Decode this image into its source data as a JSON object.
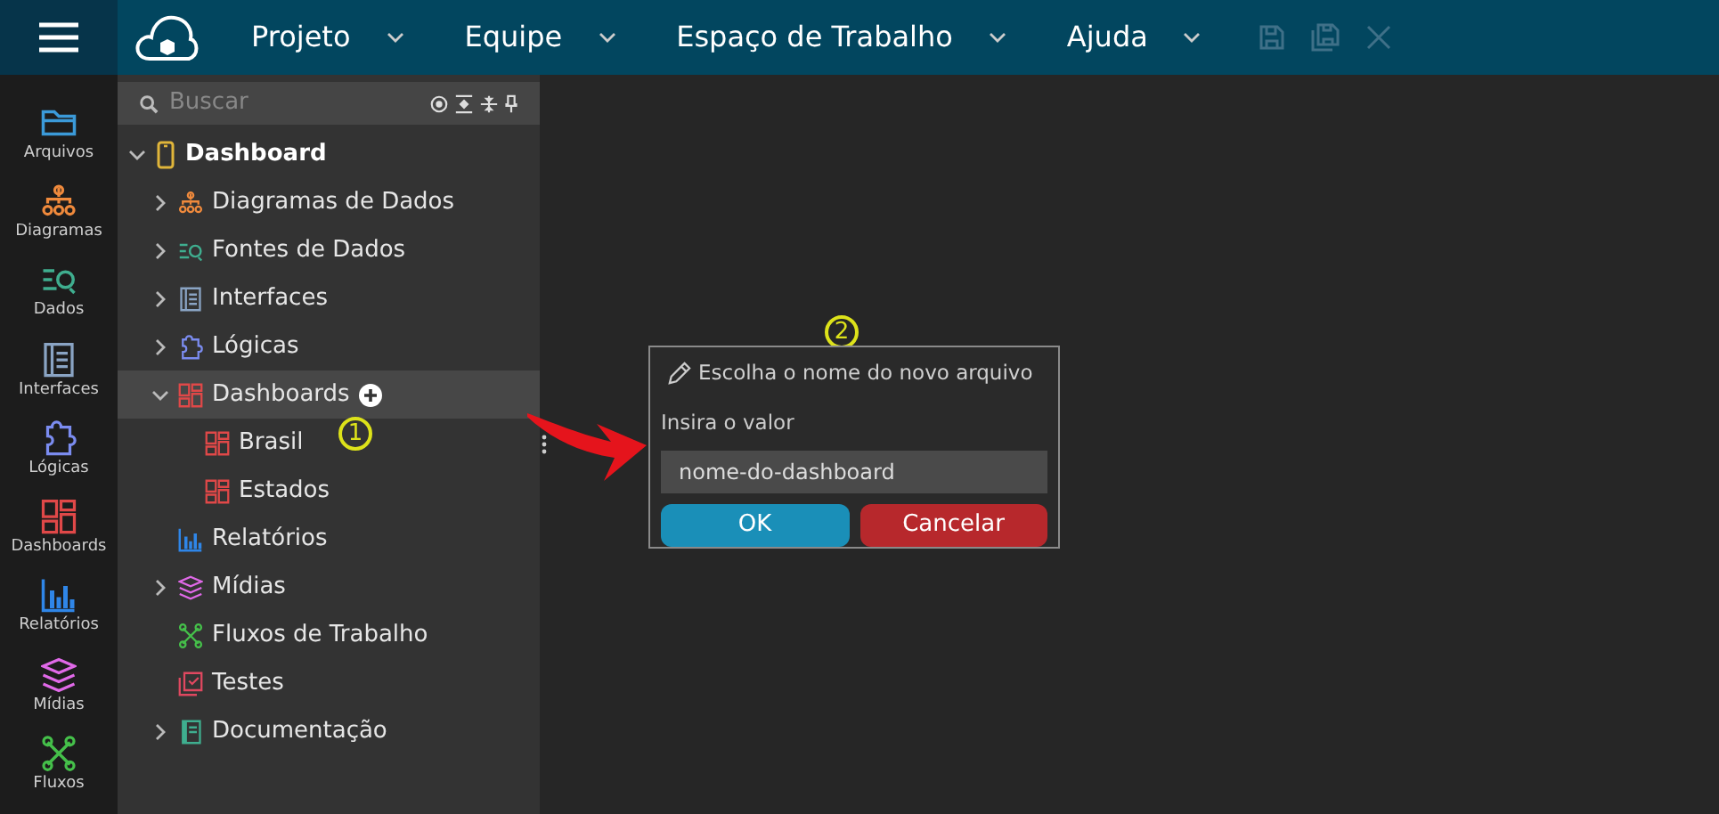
{
  "menu": [
    {
      "label": "Projeto"
    },
    {
      "label": "Equipe"
    },
    {
      "label": "Espaço de Trabalho"
    },
    {
      "label": "Ajuda"
    }
  ],
  "rail": [
    {
      "label": "Arquivos",
      "kind": "folder",
      "color": "#3b9ad9"
    },
    {
      "label": "Diagramas",
      "kind": "diagram",
      "color": "#f08a3c"
    },
    {
      "label": "Dados",
      "kind": "data",
      "color": "#3fae8f"
    },
    {
      "label": "Interfaces",
      "kind": "interface",
      "color": "#8aa4c4"
    },
    {
      "label": "Lógicas",
      "kind": "logic",
      "color": "#7b8cf0"
    },
    {
      "label": "Dashboards",
      "kind": "dashboard",
      "color": "#e04848"
    },
    {
      "label": "Relatórios",
      "kind": "report",
      "color": "#2f86e8"
    },
    {
      "label": "Mídias",
      "kind": "media",
      "color": "#e069e8"
    },
    {
      "label": "Fluxos",
      "kind": "flow",
      "color": "#45c04a"
    }
  ],
  "search": {
    "placeholder": "Buscar"
  },
  "tree": {
    "label": "Dashboard",
    "expanded": true,
    "children": [
      {
        "label": "Diagramas de Dados",
        "kind": "diagram",
        "color": "#f08a3c",
        "expanded": false,
        "selected": false
      },
      {
        "label": "Fontes de Dados",
        "kind": "data",
        "color": "#3fae8f",
        "expanded": false,
        "selected": false
      },
      {
        "label": "Interfaces",
        "kind": "interface",
        "color": "#8aa4c4",
        "expanded": false,
        "selected": false
      },
      {
        "label": "Lógicas",
        "kind": "logic",
        "color": "#7b8cf0",
        "expanded": false,
        "selected": false
      },
      {
        "label": "Dashboards",
        "kind": "dashboard",
        "color": "#e04848",
        "expanded": true,
        "selected": true,
        "children": [
          {
            "label": "Brasil",
            "kind": "dashboard",
            "color": "#e04848",
            "selected": false
          },
          {
            "label": "Estados",
            "kind": "dashboard",
            "color": "#e04848",
            "selected": false
          }
        ]
      },
      {
        "label": "Relatórios",
        "kind": "report",
        "color": "#2f86e8",
        "selected": false
      },
      {
        "label": "Mídias",
        "kind": "media",
        "color": "#e069e8",
        "expanded": false,
        "selected": false
      },
      {
        "label": "Fluxos de Trabalho",
        "kind": "flow",
        "color": "#45c04a",
        "selected": false
      },
      {
        "label": "Testes",
        "kind": "test",
        "color": "#e04860",
        "selected": false
      },
      {
        "label": "Documentação",
        "kind": "doc",
        "color": "#3fae8f",
        "expanded": false,
        "selected": false
      }
    ]
  },
  "annotations": [
    "1",
    "2"
  ],
  "dialog": {
    "title": "Escolha o nome do novo arquivo",
    "label": "Insira o valor",
    "value": "nome-do-dashboard",
    "buttons": [
      {
        "label": "OK",
        "kind": "primary"
      },
      {
        "label": "Cancelar",
        "kind": "danger"
      }
    ]
  }
}
